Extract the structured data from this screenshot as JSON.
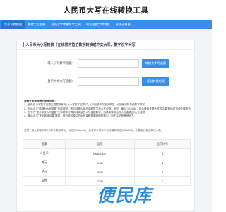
{
  "header": {
    "title": "人民币大写在线转换工具"
  },
  "nav": {
    "items": [
      {
        "label": "大小写转换器"
      },
      {
        "label": "繁转大写金额"
      },
      {
        "label": "在线汉字转繁体字工具"
      },
      {
        "label": "阿拉伯数字转换器"
      },
      {
        "label": "在线计算器"
      }
    ]
  },
  "card": {
    "title": "人民币大小写转换（在线将阿拉伯数字转换成中文大写、数字汉字大写）",
    "input_row": {
      "label": "输入小写数字金额：",
      "value": "",
      "placeholder": "",
      "button": "转换为大写金额"
    },
    "output_row": {
      "label": "显示中文大写金额：",
      "value": "",
      "placeholder": "",
      "button": "复制转换结果"
    }
  },
  "notes": {
    "heading": "金额大写转换器的使用说明：",
    "lines": [
      "1、首先在小写数字金额文框里填写\"输入小写数字金额\"中，(不用带中文数字单位，必须使用阿拉伯数字填写)",
      "2、然后点击\"转换为大写金额\"功能按钮，即可转换人民币金额数字为大写金额，例如：输入\"123456\"，将会得到金额大写的结果(壹拾贰万叁仟肆佰伍拾陆元整)",
      "3、在下方\"显示中文大写金额\"文本框中可得到转换后的大写金额数字，结果由转换后的大写金额(即大写金额)",
      "4、最后点击\"复制转换结果\"按钮，即可将转换后的大写金额复制到剪贴板中，用于粘贴到其他地方。"
    ]
  },
  "hint": "注意：输入的数字不以0和小数点开头，(例如99999.99)，也不可以带有千位分隔符(例如9,999.99)，小数部分保留两位小数。",
  "table": {
    "headers": [
      "国家",
      "货币",
      "货币符号"
    ],
    "rows": [
      [
        "人民币",
        "RMB(CNY)",
        "¥"
      ],
      [
        "美元",
        "USD",
        "$"
      ],
      [
        "欧元",
        "EUR",
        "€"
      ],
      [
        "英镑",
        "GBP",
        "£"
      ]
    ]
  },
  "watermark": {
    "text": "便民库"
  },
  "colors": {
    "accent": "#3a8ee6",
    "page_bg": "#f2f4f7",
    "watermark": "#2a8cdb"
  }
}
